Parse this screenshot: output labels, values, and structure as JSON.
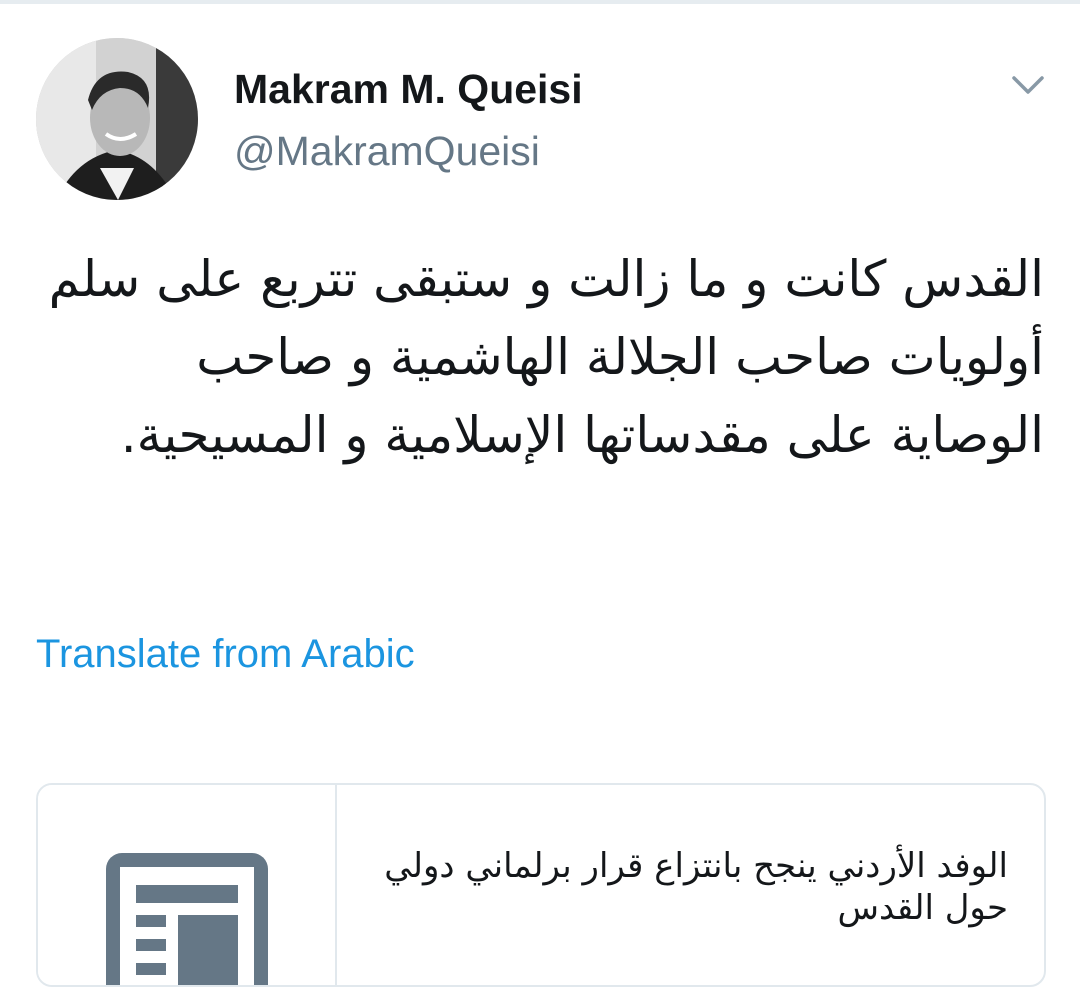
{
  "tweet": {
    "author": {
      "display_name": "Makram M. Queisi",
      "handle": "@MakramQueisi",
      "avatar_icon": "profile-photo"
    },
    "menu_icon": "chevron-down-icon",
    "text": "القدس كانت و ما زالت و ستبقى تتربع على سلم أولويات صاحب الجلالة الهاشمية و صاحب الوصاية على مقدساتها الإسلامية و المسيحية.",
    "translate_label": "Translate from Arabic",
    "card": {
      "icon": "article-icon",
      "title": "الوفد الأردني ينجح بانتزاع قرار برلماني دولي حول القدس"
    }
  },
  "colors": {
    "text_primary": "#14171a",
    "text_secondary": "#657786",
    "link": "#1b95e0",
    "border": "#e1e8ed",
    "icon_gray": "#657786",
    "caret": "#8899a6"
  }
}
